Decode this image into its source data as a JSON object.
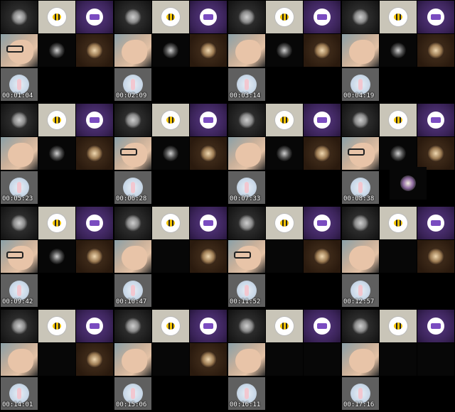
{
  "sheet": {
    "frames": [
      {
        "time": "00:01:04",
        "row2": [
          "face-glasses",
          "spinner",
          "bronze"
        ],
        "row3_extra": false
      },
      {
        "time": "00:02:09",
        "row2": [
          "face",
          "spinner",
          "bronze"
        ],
        "row3_extra": false
      },
      {
        "time": "00:03:14",
        "row2": [
          "face",
          "spinner",
          "bronze"
        ],
        "row3_extra": false
      },
      {
        "time": "00:04:19",
        "row2": [
          "face",
          "spinner",
          "bronze"
        ],
        "row3_extra": false
      },
      {
        "time": "00:05:23",
        "row2": [
          "face",
          "spinner",
          "bronze"
        ],
        "row3_extra": false
      },
      {
        "time": "00:06:28",
        "row2": [
          "face-glasses",
          "spinner",
          "bronze"
        ],
        "row3_extra": false
      },
      {
        "time": "00:07:33",
        "row2": [
          "face",
          "spinner",
          "bronze"
        ],
        "row3_extra": false
      },
      {
        "time": "00:08:38",
        "row2": [
          "face-glasses",
          "spinner",
          "bronze"
        ],
        "row3_extra": true
      },
      {
        "time": "00:09:42",
        "row2": [
          "face-glasses",
          "spinner",
          "bronze"
        ],
        "row3_extra": false
      },
      {
        "time": "00:10:47",
        "row2": [
          "face",
          "blank",
          "bronze"
        ],
        "row3_extra": false
      },
      {
        "time": "00:11:52",
        "row2": [
          "face-glasses",
          "blank",
          "bronze"
        ],
        "row3_extra": false
      },
      {
        "time": "00:12:57",
        "row2": [
          "face",
          "blank",
          "bronze"
        ],
        "row3_extra": false
      },
      {
        "time": "00:14:01",
        "row2": [
          "face",
          "blank",
          "bronze"
        ],
        "row3_extra": false
      },
      {
        "time": "00:15:06",
        "row2": [
          "face",
          "blank",
          "bronze"
        ],
        "row3_extra": false
      },
      {
        "time": "00:16:11",
        "row2": [
          "face",
          "blank",
          "blank"
        ],
        "row3_extra": false
      },
      {
        "time": "00:17:16",
        "row2": [
          "face",
          "blank",
          "blank"
        ],
        "row3_extra": false
      }
    ]
  }
}
